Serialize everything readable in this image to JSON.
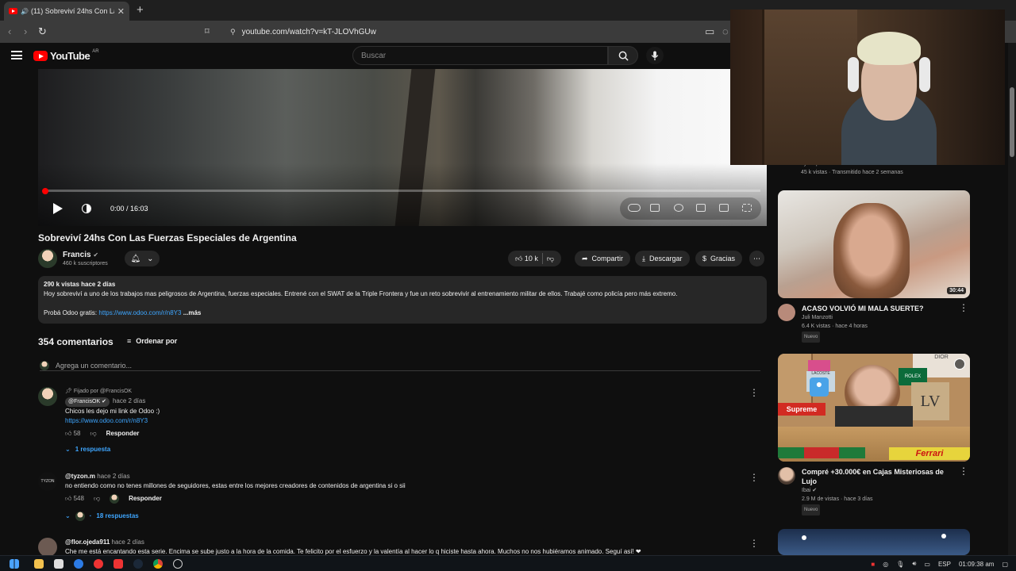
{
  "browser": {
    "tab_title": "(11) Sobreviví 24hs Con Las F",
    "url": "youtube.com/watch?v=kT-JLOVhGUw"
  },
  "header": {
    "logo": "YouTube",
    "region": "AR",
    "search_placeholder": "Buscar"
  },
  "player": {
    "time": "0:00 / 16:03",
    "progress": 0.002
  },
  "video": {
    "title": "Sobreviví 24hs Con Las Fuerzas Especiales de Argentina",
    "channel": "Francis",
    "subscribers": "460 k suscriptores",
    "likes": "10 k",
    "share": "Compartir",
    "download": "Descargar",
    "thanks": "Gracias"
  },
  "description": {
    "stats": "290 k vistas  hace 2 días",
    "text": "Hoy sobreviví a uno de los trabajos mas peligrosos de Argentina, fuerzas especiales. Entrené con el SWAT de la Triple Frontera y fue un reto sobrevivir al entrenamiento militar de ellos. Trabajé como policía pero más extremo.",
    "promo_prefix": "Probá Odoo gratis:",
    "promo_link": "https://www.odoo.com/r/n8Y3",
    "more": "...más"
  },
  "comments": {
    "count": "354 comentarios",
    "sort": "Ordenar por",
    "add_placeholder": "Agrega un comentario...",
    "items": [
      {
        "pinned": "Fijado por @FrancisOK",
        "author": "@FrancisOK",
        "time": "hace 2 días",
        "text": "Chicos les dejo mi link de Odoo :)",
        "link": "https://www.odoo.com/r/n8Y3",
        "likes": "58",
        "reply": "Responder",
        "replies": "1 respuesta"
      },
      {
        "author": "@tyzon.m",
        "time": "hace 2 días",
        "text": "no entiendo como no tenes millones de seguidores, estas entre los mejores creadores de contenidos de argentina si o sii",
        "likes": "548",
        "reply": "Responder",
        "replies": "18 respuestas"
      },
      {
        "author": "@flor.ojeda911",
        "time": "hace 2 días",
        "text": "Che me está encantando esta serie. Encima se sube justo a la hora de la comida. Te felicito por el esfuerzo y la valentía al hacer lo q hiciste hasta ahora. Muchos no nos hubiéramos animado. Seguí así! ❤"
      }
    ]
  },
  "sidebar": {
    "partial_channel": "TyC Sports",
    "partial_meta": "45 k vistas · Transmitido hace 2 semanas",
    "recs": [
      {
        "title": "ACASO VOLVIÓ MI MALA SUERTE?",
        "channel": "Juli Manzotti",
        "meta": "6.4 K vistas · hace 4 horas",
        "badge": "Nuevo",
        "duration": "30:44"
      },
      {
        "title": "Compré +30.000€ en Cajas Misteriosas de Lujo",
        "channel": "Ibai",
        "meta": "2.9 M de vistas · hace 3 días",
        "badge": "Nuevo",
        "brands": [
          "DIOR",
          "ROLEX",
          "LACOSTE",
          "Supreme",
          "Ferrari"
        ]
      }
    ]
  },
  "taskbar": {
    "lang": "ESP",
    "clock": "01:09:38 am"
  }
}
